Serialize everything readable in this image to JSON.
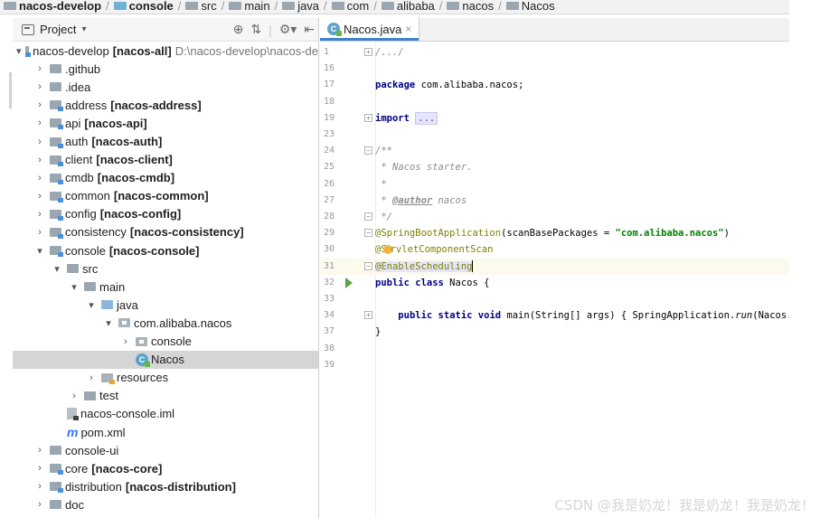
{
  "breadcrumb": [
    "nacos-develop",
    "console",
    "src",
    "main",
    "java",
    "com",
    "alibaba",
    "nacos",
    "Nacos"
  ],
  "project_panel": {
    "title": "Project",
    "tree": [
      {
        "depth": 0,
        "arrow": "▾",
        "icon": "module",
        "name": "nacos-develop",
        "suffix": "[nacos-all]",
        "path": "D:\\nacos-develop\\nacos-de"
      },
      {
        "depth": 1,
        "arrow": "›",
        "icon": "folder",
        "name": ".github",
        "suffix": ""
      },
      {
        "depth": 1,
        "arrow": "›",
        "icon": "folder",
        "name": ".idea",
        "suffix": ""
      },
      {
        "depth": 1,
        "arrow": "›",
        "icon": "module",
        "name": "address",
        "suffix": "[nacos-address]"
      },
      {
        "depth": 1,
        "arrow": "›",
        "icon": "module",
        "name": "api",
        "suffix": "[nacos-api]"
      },
      {
        "depth": 1,
        "arrow": "›",
        "icon": "module",
        "name": "auth",
        "suffix": "[nacos-auth]"
      },
      {
        "depth": 1,
        "arrow": "›",
        "icon": "module",
        "name": "client",
        "suffix": "[nacos-client]"
      },
      {
        "depth": 1,
        "arrow": "›",
        "icon": "module",
        "name": "cmdb",
        "suffix": "[nacos-cmdb]"
      },
      {
        "depth": 1,
        "arrow": "›",
        "icon": "module",
        "name": "common",
        "suffix": "[nacos-common]"
      },
      {
        "depth": 1,
        "arrow": "›",
        "icon": "module",
        "name": "config",
        "suffix": "[nacos-config]"
      },
      {
        "depth": 1,
        "arrow": "›",
        "icon": "module",
        "name": "consistency",
        "suffix": "[nacos-consistency]"
      },
      {
        "depth": 1,
        "arrow": "▾",
        "icon": "module",
        "name": "console",
        "suffix": "[nacos-console]"
      },
      {
        "depth": 2,
        "arrow": "▾",
        "icon": "folder",
        "name": "src",
        "suffix": ""
      },
      {
        "depth": 3,
        "arrow": "▾",
        "icon": "folder",
        "name": "main",
        "suffix": ""
      },
      {
        "depth": 4,
        "arrow": "▾",
        "icon": "source",
        "name": "java",
        "suffix": ""
      },
      {
        "depth": 5,
        "arrow": "▾",
        "icon": "package",
        "name": "com.alibaba.nacos",
        "suffix": ""
      },
      {
        "depth": 6,
        "arrow": "›",
        "icon": "package",
        "name": "console",
        "suffix": ""
      },
      {
        "depth": 6,
        "arrow": "",
        "icon": "class",
        "name": "Nacos",
        "suffix": "",
        "selected": true
      },
      {
        "depth": 4,
        "arrow": "›",
        "icon": "resources",
        "name": "resources",
        "suffix": ""
      },
      {
        "depth": 3,
        "arrow": "›",
        "icon": "folder",
        "name": "test",
        "suffix": ""
      },
      {
        "depth": 2,
        "arrow": "",
        "icon": "iml",
        "name": "nacos-console.iml",
        "suffix": ""
      },
      {
        "depth": 2,
        "arrow": "",
        "icon": "maven",
        "name": "pom.xml",
        "suffix": ""
      },
      {
        "depth": 1,
        "arrow": "›",
        "icon": "folder",
        "name": "console-ui",
        "suffix": ""
      },
      {
        "depth": 1,
        "arrow": "›",
        "icon": "module",
        "name": "core",
        "suffix": "[nacos-core]"
      },
      {
        "depth": 1,
        "arrow": "›",
        "icon": "module",
        "name": "distribution",
        "suffix": "[nacos-distribution]"
      },
      {
        "depth": 1,
        "arrow": "›",
        "icon": "folder",
        "name": "doc",
        "suffix": ""
      }
    ]
  },
  "editor": {
    "tab_label": "Nacos.java",
    "lines": [
      {
        "no": "1",
        "fold": "+",
        "html": "<span class='cm'>/.../</span>"
      },
      {
        "no": "16",
        "html": ""
      },
      {
        "no": "17",
        "html": "<span class='kw'>package</span> com.alibaba.nacos;"
      },
      {
        "no": "18",
        "html": ""
      },
      {
        "no": "19",
        "fold": "+",
        "html": "<span class='kw'>import</span> <span class='fold-box'>...</span>"
      },
      {
        "no": "23",
        "html": ""
      },
      {
        "no": "24",
        "fold": "-",
        "html": "<span class='cm'>/**</span>"
      },
      {
        "no": "25",
        "html": "<span class='cm'> * Nacos starter.</span>"
      },
      {
        "no": "26",
        "html": "<span class='cm'> *</span>"
      },
      {
        "no": "27",
        "html": "<span class='cm'> * </span><span class='tag'>@author</span><span class='cm'> nacos</span>"
      },
      {
        "no": "28",
        "fold": "-",
        "html": "<span class='cm'> */</span>"
      },
      {
        "no": "29",
        "fold": "-",
        "html": "<span class='ann'>@SpringBootApplication</span>(scanBasePackages = <span class='str'>\"com.alibaba.nacos\"</span>)"
      },
      {
        "no": "30",
        "html": "<span class='ann'>@S<span class='bulb'></span>rvletComponentScan</span>"
      },
      {
        "no": "31",
        "fold": "-",
        "current": true,
        "html": "<span class='ann ann-hl'>@EnableScheduling</span><span class='caret'></span>"
      },
      {
        "no": "32",
        "run": true,
        "html": "<span class='kw'>public class</span> Nacos {"
      },
      {
        "no": "33",
        "html": ""
      },
      {
        "no": "34",
        "fold": "+",
        "html": "    <span class='kw'>public static void</span> main(String[] args) { SpringApplication.<i>run</i>(Nacos.<span class='kw'>class</span>"
      },
      {
        "no": "37",
        "html": "}"
      },
      {
        "no": "38",
        "html": ""
      },
      {
        "no": "39",
        "html": ""
      }
    ]
  },
  "watermark": "CSDN @我是奶龙！我是奶龙！我是奶龙！"
}
